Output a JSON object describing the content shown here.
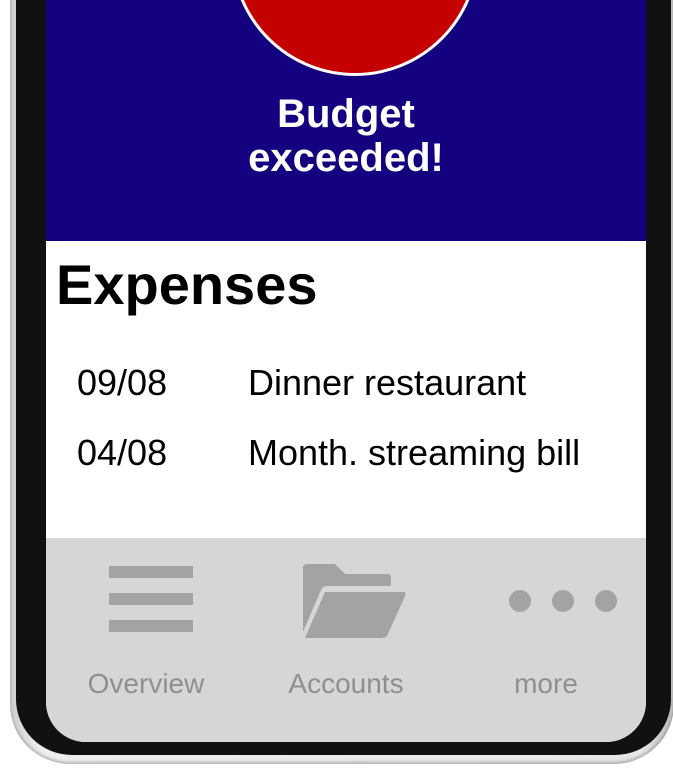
{
  "alert": {
    "message_line1": "Budget",
    "message_line2": "exceeded!",
    "background_color": "#140180",
    "circle_color": "#c40000"
  },
  "expenses": {
    "title": "Expenses",
    "items": [
      {
        "date": "09/08",
        "description": "Dinner restaurant"
      },
      {
        "date": "04/08",
        "description": "Month. streaming bill"
      }
    ]
  },
  "nav": {
    "items": [
      {
        "label": "Overview",
        "icon": "menu-icon"
      },
      {
        "label": "Accounts",
        "icon": "folder-icon"
      },
      {
        "label": "more",
        "icon": "more-icon"
      }
    ]
  }
}
